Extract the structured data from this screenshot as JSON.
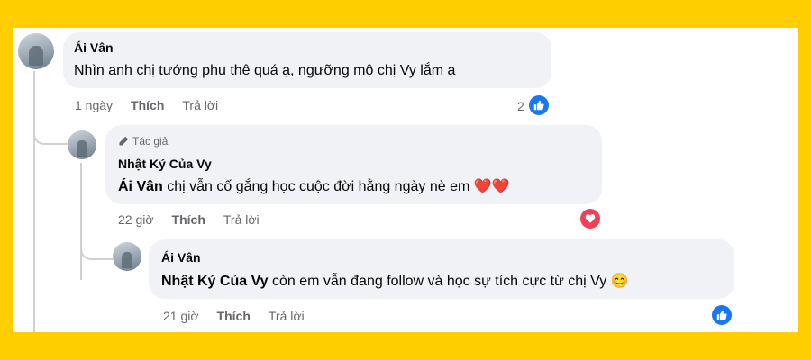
{
  "comment1": {
    "author": "Ái Vân",
    "text": "Nhìn anh chị tướng phu thê quá ạ, ngưỡng mộ chị Vy lắm ạ",
    "time": "1 ngày",
    "like_label": "Thích",
    "reply_label": "Trả lời",
    "reaction_count": "2",
    "reaction_icon": "thumbs-up-icon"
  },
  "reply1": {
    "badge": "Tác giả",
    "author": "Nhật Ký Của Vy",
    "mention": "Ái Vân",
    "text": " chị vẫn cố gắng học cuộc đời hằng ngày nè em ",
    "emoji": "❤️❤️",
    "time": "22 giờ",
    "like_label": "Thích",
    "reply_label": "Trả lời",
    "reaction_icon": "heart-icon"
  },
  "reply2": {
    "author": "Ái Vân",
    "mention": "Nhật Ký Của Vy",
    "text": " còn em vẫn đang follow và học sự tích cực từ chị Vy ",
    "emoji": "😊",
    "time": "21 giờ",
    "like_label": "Thích",
    "reply_label": "Trả lời",
    "reaction_icon": "thumbs-up-icon"
  },
  "colors": {
    "frame": "#FECE00",
    "bubble": "#F0F2F5",
    "like_blue": "#1877F2",
    "heart_red": "#F33E58"
  }
}
